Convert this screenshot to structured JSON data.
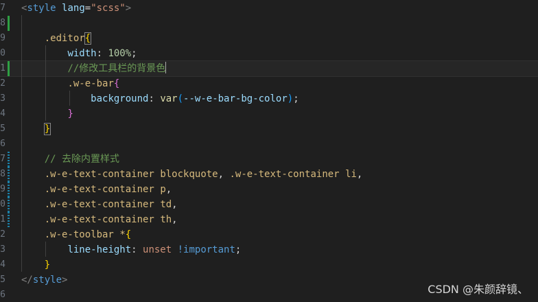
{
  "editor": {
    "lines": [
      {
        "num": "7",
        "tokens": [
          [
            "tok-punc",
            "<"
          ],
          [
            "tok-tag",
            "style"
          ],
          [
            "tok-plain",
            " "
          ],
          [
            "tok-attr",
            "lang"
          ],
          [
            "tok-plain",
            "="
          ],
          [
            "tok-str",
            "\"scss\""
          ],
          [
            "tok-punc",
            ">"
          ]
        ]
      },
      {
        "num": "8",
        "tokens": []
      },
      {
        "num": "9",
        "tokens": [
          [
            "tok-plain",
            "    "
          ],
          [
            "tok-sel",
            ".editor"
          ],
          [
            "tok-brace-y",
            "{"
          ]
        ]
      },
      {
        "num": "0",
        "tokens": [
          [
            "tok-plain",
            "        "
          ],
          [
            "tok-prop",
            "width"
          ],
          [
            "tok-plain",
            ": "
          ],
          [
            "tok-num",
            "100%"
          ],
          [
            "tok-plain",
            ";"
          ]
        ]
      },
      {
        "num": "1",
        "tokens": [
          [
            "tok-plain",
            "        "
          ],
          [
            "tok-comment",
            "//修改工具栏的背景色"
          ]
        ]
      },
      {
        "num": "2",
        "tokens": [
          [
            "tok-plain",
            "        "
          ],
          [
            "tok-sel",
            ".w-e-bar"
          ],
          [
            "tok-brace-p",
            "{"
          ]
        ]
      },
      {
        "num": "3",
        "tokens": [
          [
            "tok-plain",
            "            "
          ],
          [
            "tok-prop",
            "background"
          ],
          [
            "tok-plain",
            ": "
          ],
          [
            "tok-fn",
            "var"
          ],
          [
            "tok-brace-b",
            "("
          ],
          [
            "tok-var",
            "--w-e-bar-bg-color"
          ],
          [
            "tok-brace-b",
            ")"
          ],
          [
            "tok-plain",
            ";"
          ]
        ]
      },
      {
        "num": "4",
        "tokens": [
          [
            "tok-plain",
            "        "
          ],
          [
            "tok-brace-p",
            "}"
          ]
        ]
      },
      {
        "num": "5",
        "tokens": [
          [
            "tok-plain",
            "    "
          ],
          [
            "tok-brace-y",
            "}"
          ]
        ]
      },
      {
        "num": "6",
        "tokens": []
      },
      {
        "num": "7",
        "tokens": [
          [
            "tok-plain",
            "    "
          ],
          [
            "tok-comment",
            "// 去除内置样式"
          ]
        ]
      },
      {
        "num": "8",
        "tokens": [
          [
            "tok-plain",
            "    "
          ],
          [
            "tok-sel",
            ".w-e-text-container"
          ],
          [
            "tok-plain",
            " "
          ],
          [
            "tok-sel",
            "blockquote"
          ],
          [
            "tok-plain",
            ", "
          ],
          [
            "tok-sel",
            ".w-e-text-container"
          ],
          [
            "tok-plain",
            " "
          ],
          [
            "tok-sel",
            "li"
          ],
          [
            "tok-plain",
            ","
          ]
        ]
      },
      {
        "num": "9",
        "tokens": [
          [
            "tok-plain",
            "    "
          ],
          [
            "tok-sel",
            ".w-e-text-container"
          ],
          [
            "tok-plain",
            " "
          ],
          [
            "tok-sel",
            "p"
          ],
          [
            "tok-plain",
            ","
          ]
        ]
      },
      {
        "num": "0",
        "tokens": [
          [
            "tok-plain",
            "    "
          ],
          [
            "tok-sel",
            ".w-e-text-container"
          ],
          [
            "tok-plain",
            " "
          ],
          [
            "tok-sel",
            "td"
          ],
          [
            "tok-plain",
            ","
          ]
        ]
      },
      {
        "num": "1",
        "tokens": [
          [
            "tok-plain",
            "    "
          ],
          [
            "tok-sel",
            ".w-e-text-container"
          ],
          [
            "tok-plain",
            " "
          ],
          [
            "tok-sel",
            "th"
          ],
          [
            "tok-plain",
            ","
          ]
        ]
      },
      {
        "num": "2",
        "tokens": [
          [
            "tok-plain",
            "    "
          ],
          [
            "tok-sel",
            ".w-e-toolbar"
          ],
          [
            "tok-plain",
            " "
          ],
          [
            "tok-sel",
            "*"
          ],
          [
            "tok-brace-y",
            "{"
          ]
        ]
      },
      {
        "num": "3",
        "tokens": [
          [
            "tok-plain",
            "        "
          ],
          [
            "tok-prop",
            "line-height"
          ],
          [
            "tok-plain",
            ": "
          ],
          [
            "tok-unset",
            "unset"
          ],
          [
            "tok-plain",
            " "
          ],
          [
            "tok-important",
            "!important"
          ],
          [
            "tok-plain",
            ";"
          ]
        ]
      },
      {
        "num": "4",
        "tokens": [
          [
            "tok-plain",
            "    "
          ],
          [
            "tok-brace-y",
            "}"
          ]
        ]
      },
      {
        "num": "5",
        "tokens": [
          [
            "tok-punc",
            "</"
          ],
          [
            "tok-tag",
            "style"
          ],
          [
            "tok-punc",
            ">"
          ]
        ]
      },
      {
        "num": "6",
        "tokens": []
      }
    ],
    "current_line_index": 4,
    "gutter_marks": {
      "added": [
        1,
        4
      ],
      "modified": [
        10,
        11,
        12,
        13,
        14
      ]
    }
  },
  "watermark": {
    "text": "CSDN @朱颜辞镜、"
  }
}
